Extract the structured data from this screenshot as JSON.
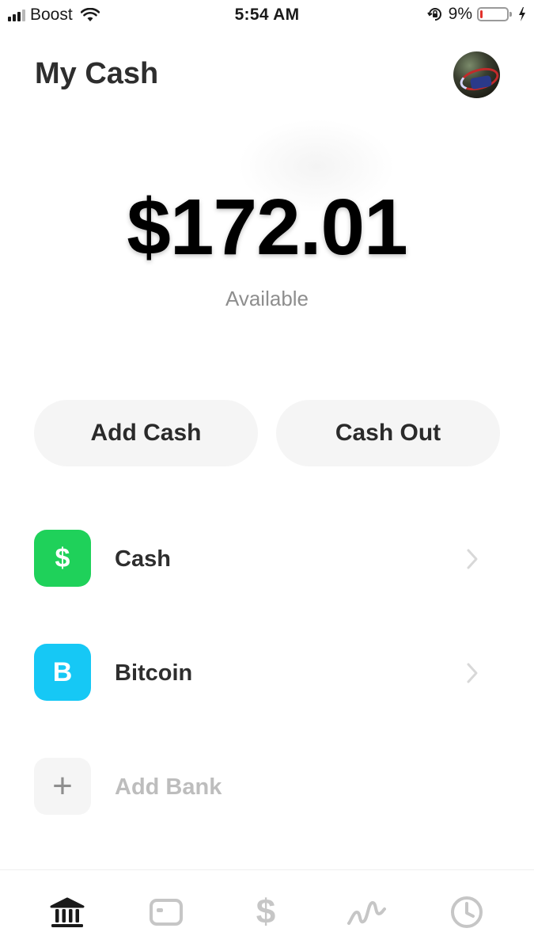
{
  "status_bar": {
    "carrier": "Boost",
    "time": "5:54 AM",
    "battery_percent": "9%",
    "battery_level": 0.09,
    "icons": [
      "signal-icon",
      "wifi-icon",
      "rotation-lock-icon",
      "battery-icon",
      "charging-icon"
    ]
  },
  "header": {
    "title": "My Cash",
    "avatar_icon": "profile-avatar"
  },
  "balance": {
    "amount": "$172.01",
    "label": "Available"
  },
  "actions": {
    "add_cash": "Add Cash",
    "cash_out": "Cash Out"
  },
  "accounts": [
    {
      "icon_glyph": "$",
      "icon": "cash-icon",
      "label": "Cash",
      "color": "#1fd15a"
    },
    {
      "icon_glyph": "B",
      "icon": "bitcoin-icon",
      "label": "Bitcoin",
      "color": "#16c8f5"
    },
    {
      "icon_glyph": "+",
      "icon": "plus-icon",
      "label": "Add Bank",
      "color": "#f5f5f5"
    }
  ],
  "nav": {
    "items": [
      "bank-home-icon",
      "card-icon",
      "dollar-icon",
      "activity-icon",
      "clock-icon"
    ],
    "pay_glyph": "$",
    "active": "bank-home-icon"
  },
  "colors": {
    "cash_green": "#1fd15a",
    "bitcoin_blue": "#16c8f5",
    "battery_low": "#e2312b",
    "button_bg": "#f5f5f5"
  }
}
